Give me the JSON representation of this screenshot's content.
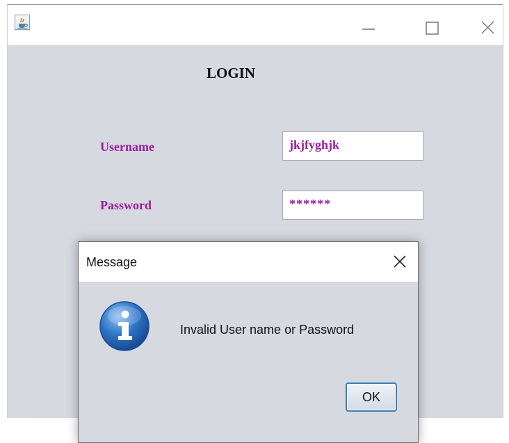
{
  "window": {
    "icon": "java-coffee-cup-icon",
    "controls": [
      "minimize-icon",
      "maximize-icon",
      "close-icon"
    ]
  },
  "form": {
    "title": "LOGIN",
    "username_label": "Username",
    "username_value": "jkjfyghjk",
    "password_label": "Password",
    "password_value": "******"
  },
  "dialog": {
    "title": "Message",
    "icon": "info-icon",
    "message": "Invalid User name or Password",
    "ok_label": "OK"
  },
  "colors": {
    "label_text": "#9c1c9c",
    "panel_background": "#d6d9e0",
    "ok_border": "#3c7fb1"
  }
}
